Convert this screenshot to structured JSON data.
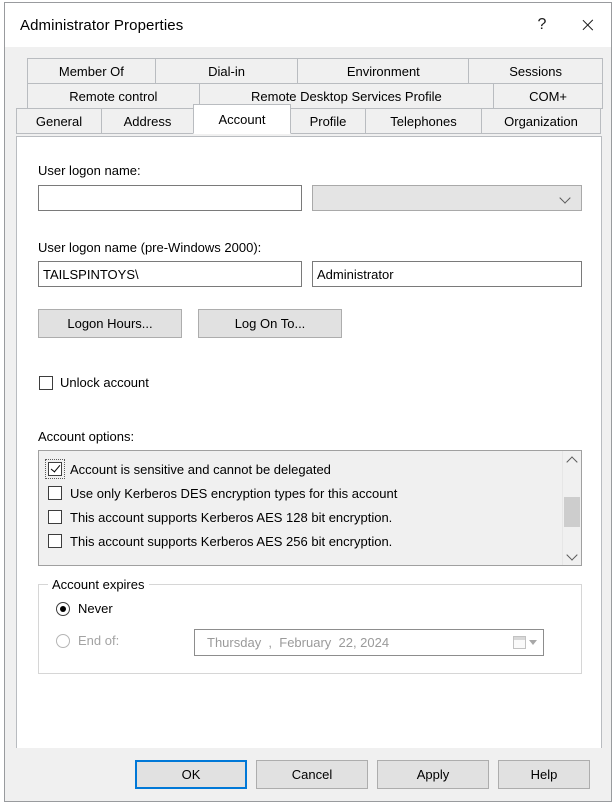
{
  "window": {
    "title": "Administrator Properties",
    "help_button": "?",
    "close_button": "✕"
  },
  "tabs": {
    "row1": [
      {
        "label": "Member Of",
        "selected": false
      },
      {
        "label": "Dial-in",
        "selected": false
      },
      {
        "label": "Environment",
        "selected": false
      },
      {
        "label": "Sessions",
        "selected": false
      }
    ],
    "row2": [
      {
        "label": "Remote control",
        "selected": false
      },
      {
        "label": "Remote Desktop Services Profile",
        "selected": false
      },
      {
        "label": "COM+",
        "selected": false
      }
    ],
    "row3": [
      {
        "label": "General",
        "selected": false
      },
      {
        "label": "Address",
        "selected": false
      },
      {
        "label": "Account",
        "selected": true
      },
      {
        "label": "Profile",
        "selected": false
      },
      {
        "label": "Telephones",
        "selected": false
      },
      {
        "label": "Organization",
        "selected": false
      }
    ]
  },
  "account": {
    "user_logon_name_label": "User logon name:",
    "user_logon_name_value": "",
    "user_logon_name_placeholder": "",
    "upn_suffix_value": "",
    "pre2000_label": "User logon name (pre-Windows 2000):",
    "pre2000_domain": "TAILSPINTOYS\\",
    "pre2000_name": "Administrator",
    "logon_hours_button": "Logon Hours...",
    "log_on_to_button": "Log On To...",
    "unlock_account_label": "Unlock account",
    "unlock_account_checked": false,
    "account_options_label": "Account options:",
    "account_options": [
      {
        "label": "Account is sensitive and cannot be delegated",
        "checked": true,
        "focused": true
      },
      {
        "label": "Use only Kerberos DES encryption types for this account",
        "checked": false,
        "focused": false
      },
      {
        "label": "This account supports Kerberos AES 128 bit encryption.",
        "checked": false,
        "focused": false
      },
      {
        "label": "This account supports Kerberos AES 256 bit encryption.",
        "checked": false,
        "focused": false
      }
    ],
    "scrollbar": {
      "up_arrow": "∧",
      "down_arrow": "∨"
    },
    "account_expires": {
      "legend": "Account expires",
      "never_label": "Never",
      "never_selected": true,
      "end_of_label": "End of:",
      "end_of_selected": false,
      "end_of_enabled": false,
      "date_value": "Thursday  ,  February  22, 2024"
    }
  },
  "footer": {
    "ok": "OK",
    "cancel": "Cancel",
    "apply": "Apply",
    "help": "Help"
  },
  "colors": {
    "accent": "#0078d7",
    "window_bg": "#f0f0f0",
    "panel_bg": "#ffffff",
    "border": "#b9bcc0"
  }
}
